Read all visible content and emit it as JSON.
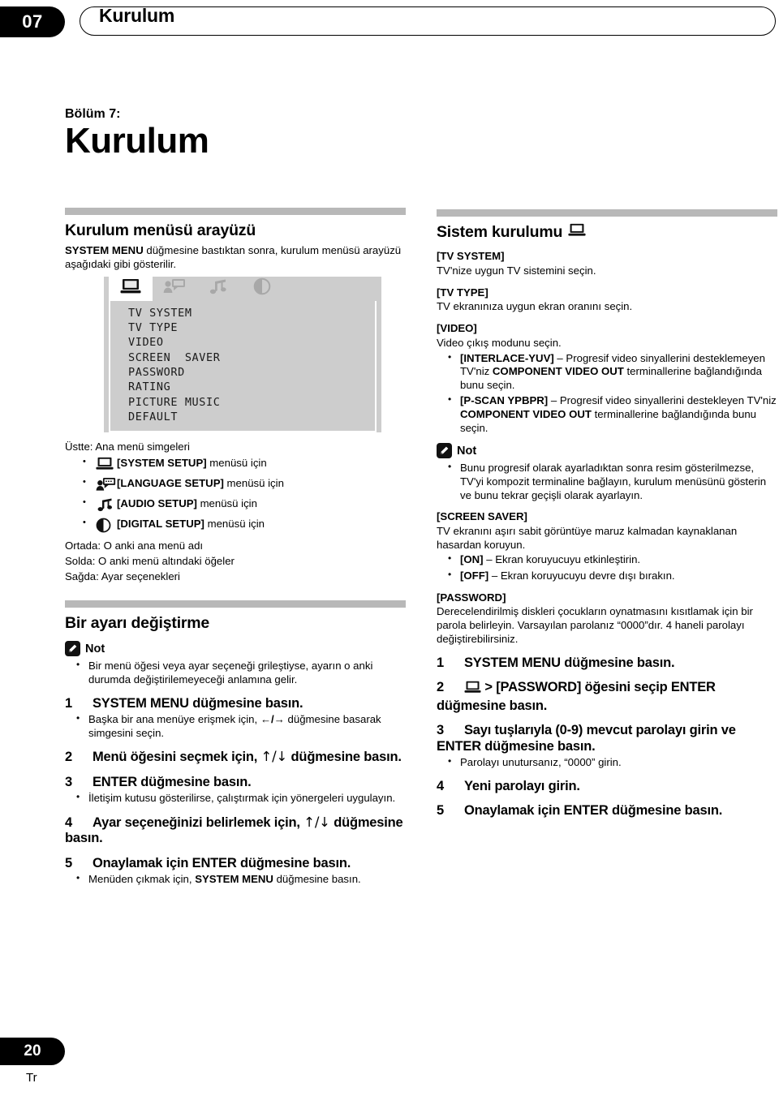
{
  "header": {
    "chapter_number": "07",
    "title": "Kurulum"
  },
  "footer": {
    "page_number": "20",
    "language_code": "Tr"
  },
  "left_column": {
    "chapter_label": "Bölüm 7:",
    "chapter_name": "Kurulum",
    "section1": {
      "heading": "Kurulum menüsü arayüzü",
      "intro_bold": "SYSTEM MENU",
      "intro_rest": " düğmesine bastıktan sonra, kurulum menüsü arayüzü aşağıdaki gibi gösterilir."
    },
    "menu_illustration": {
      "tabs": [
        {
          "icon": "monitor-icon",
          "active": true
        },
        {
          "icon": "language-person-speech-icon",
          "active": false
        },
        {
          "icon": "music-note-icon",
          "active": false
        },
        {
          "icon": "digital-circle-icon",
          "active": false
        }
      ],
      "items": [
        "TV SYSTEM",
        "TV TYPE",
        "VIDEO",
        "SCREEN  SAVER",
        "PASSWORD",
        "RATING",
        "PICTURE MUSIC",
        "DEFAULT"
      ]
    },
    "legend": {
      "top_line": "Üstte: Ana menü simgeleri",
      "icon_items": [
        {
          "icon": "monitor-icon",
          "bold": "[SYSTEM SETUP]",
          "rest": " menüsü için"
        },
        {
          "icon": "language-person-speech-icon",
          "bold": "[LANGUAGE SETUP]",
          "rest": " menüsü için"
        },
        {
          "icon": "music-note-icon",
          "bold": "[AUDIO SETUP]",
          "rest": " menüsü için"
        },
        {
          "icon": "digital-circle-icon",
          "bold": "[DIGITAL SETUP]",
          "rest": " menüsü için"
        }
      ],
      "middle_line": "Ortada: O anki ana menü adı",
      "left_line": "Solda: O anki menü altındaki öğeler",
      "right_line": "Sağda: Ayar seçenekleri"
    },
    "section2": {
      "heading": "Bir ayarı değiştirme",
      "note_label": "Not",
      "note_bullet": "Bir menü öğesi veya ayar seçeneği grileştiyse, ayarın o anki durumda değiştirilemeyeceği anlamına gelir.",
      "steps": [
        {
          "num": "1",
          "text": "SYSTEM MENU düğmesine basın.",
          "bullets": [
            {
              "pre": "Başka bir ana menüye erişmek için, ",
              "arrows": "←/→",
              "post": " düğmesine basarak simgesini seçin."
            }
          ]
        },
        {
          "num": "2",
          "pre": "Menü öğesini seçmek için, ",
          "arrows": "↑/↓",
          "post": " düğmesine basın.",
          "bullets": []
        },
        {
          "num": "3",
          "text": "ENTER düğmesine basın.",
          "bullets": [
            {
              "pre": "İletişim kutusu gösterilirse, çalıştırmak için yönergeleri uygulayın.",
              "arrows": "",
              "post": ""
            }
          ]
        },
        {
          "num": "4",
          "pre": "Ayar seçeneğinizi belirlemek için, ",
          "arrows": "↑/↓",
          "post": " düğmesine basın.",
          "bullets": []
        },
        {
          "num": "5",
          "text": "Onaylamak için ENTER düğmesine basın.",
          "bullets": [
            {
              "pre": "Menüden çıkmak için, ",
              "bold": "SYSTEM MENU",
              "post": " düğmesine basın."
            }
          ]
        }
      ]
    }
  },
  "right_column": {
    "heading": "Sistem kurulumu",
    "heading_icon": "monitor-icon",
    "entries": [
      {
        "title": "[TV SYSTEM]",
        "desc": "TV'nize uygun TV sistemini seçin."
      },
      {
        "title": "[TV TYPE]",
        "desc": "TV ekranınıza uygun ekran oranını seçin."
      },
      {
        "title": "[VIDEO]",
        "desc": "Video çıkış modunu seçin."
      }
    ],
    "video_bullets": [
      {
        "bold1": "[INTERLACE-YUV]",
        "mid1": " – Progresif video sinyallerini desteklemeyen TV'niz ",
        "bold2": "COMPONENT VIDEO OUT",
        "tail": " terminallerine bağlandığında bunu seçin."
      },
      {
        "bold1": "[P-SCAN YPBPR]",
        "mid1": " – Progresif video sinyallerini destekleyen TV'niz ",
        "bold2": "COMPONENT VIDEO OUT",
        "tail": " terminallerine bağlandığında bunu seçin."
      }
    ],
    "note": {
      "label": "Not",
      "bullet": "Bunu progresif olarak ayarladıktan sonra resim gösterilmezse, TV'yi kompozit terminaline bağlayın, kurulum menüsünü gösterin ve bunu tekrar geçişli olarak ayarlayın."
    },
    "screen_saver": {
      "title": "[SCREEN SAVER]",
      "desc": "TV ekranını aşırı sabit görüntüye maruz kalmadan kaynaklanan hasardan koruyun.",
      "bullets": [
        {
          "bold": "[ON]",
          "rest": " – Ekran koruyucuyu etkinleştirin."
        },
        {
          "bold": "[OFF]",
          "rest": " – Ekran koruyucuyu devre dışı bırakın."
        }
      ]
    },
    "password": {
      "title": "[PASSWORD]",
      "desc": "Derecelendirilmiş diskleri çocukların oynatmasını kısıtlamak için bir parola belirleyin. Varsayılan parolanız “0000”dır. 4 haneli parolayı değiştirebilirsiniz.",
      "steps": [
        {
          "num": "1",
          "text": "SYSTEM MENU düğmesine basın.",
          "bullets": []
        },
        {
          "num": "2",
          "icon": "monitor-icon",
          "text": "> [PASSWORD] öğesini seçip ENTER düğmesine basın.",
          "bullets": []
        },
        {
          "num": "3",
          "text": "Sayı tuşlarıyla (0-9) mevcut parolayı girin ve ENTER düğmesine basın.",
          "bullets": [
            {
              "text": "Parolayı unutursanız, “0000” girin."
            }
          ]
        },
        {
          "num": "4",
          "text": "Yeni parolayı girin.",
          "bullets": []
        },
        {
          "num": "5",
          "text": "Onaylamak için ENTER düğmesine basın.",
          "bullets": []
        }
      ]
    }
  },
  "colors": {
    "rule_gray": "#b8b8b8",
    "menu_gray": "#cdcdcd",
    "black": "#000000"
  }
}
